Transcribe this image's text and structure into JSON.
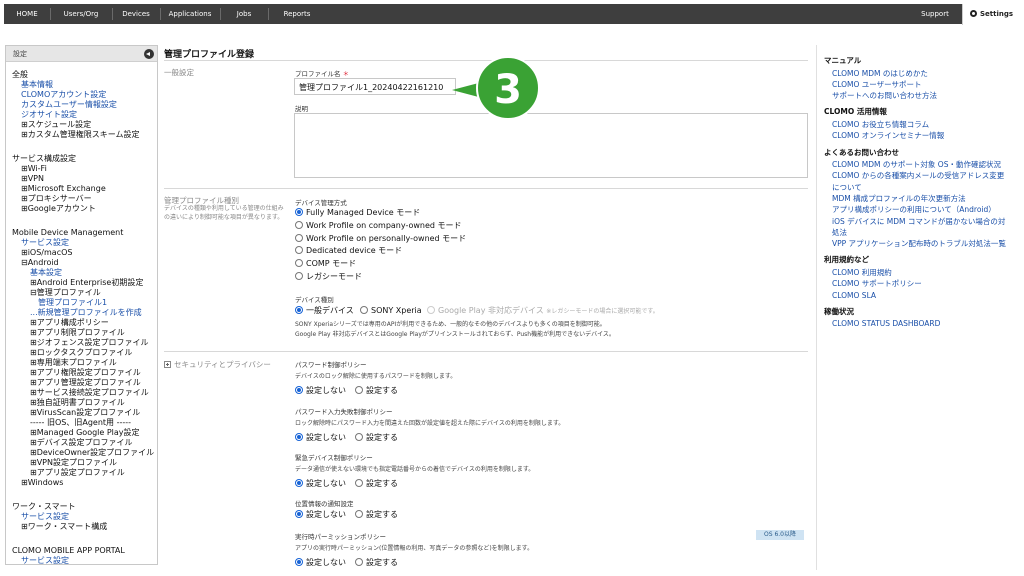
{
  "nav": {
    "items": [
      "HOME",
      "Users/Org",
      "Devices",
      "Applications",
      "Jobs",
      "Reports"
    ],
    "support": "Support",
    "settings": "Settings"
  },
  "sidebar": {
    "title": "設定",
    "items": [
      {
        "text": "全般",
        "kind": "head"
      },
      {
        "text": "基本情報",
        "kind": "link"
      },
      {
        "text": "CLOMOアカウント設定",
        "kind": "link"
      },
      {
        "text": "カスタムユーザー情報設定",
        "kind": "link"
      },
      {
        "text": "ジオサイト設定",
        "kind": "link"
      },
      {
        "text": "⊞スケジュール設定",
        "kind": "head"
      },
      {
        "text": "⊞カスタム管理権限スキーム設定",
        "kind": "head"
      },
      {
        "text": "サービス構成設定",
        "kind": "head"
      },
      {
        "text": "⊞Wi-Fi",
        "kind": "head"
      },
      {
        "text": "⊞VPN",
        "kind": "head"
      },
      {
        "text": "⊞Microsoft Exchange",
        "kind": "head"
      },
      {
        "text": "⊞プロキシサーバー",
        "kind": "head"
      },
      {
        "text": "⊞Googleアカウント",
        "kind": "head"
      },
      {
        "text": "Mobile Device Management",
        "kind": "head"
      },
      {
        "text": "サービス設定",
        "kind": "link"
      },
      {
        "text": "⊞iOS/macOS",
        "kind": "head"
      },
      {
        "text": "⊟Android",
        "kind": "head"
      },
      {
        "text": "基本設定",
        "kind": "link"
      },
      {
        "text": "⊞Android Enterprise初期設定",
        "kind": "head"
      },
      {
        "text": "⊟管理プロファイル",
        "kind": "head"
      },
      {
        "text": "管理プロファイル1",
        "kind": "link"
      },
      {
        "text": "...新規管理プロファイルを作成",
        "kind": "link"
      },
      {
        "text": "⊞アプリ構成ポリシー",
        "kind": "head"
      },
      {
        "text": "⊞アプリ制限プロファイル",
        "kind": "head"
      },
      {
        "text": "⊞ジオフェンス設定プロファイル",
        "kind": "head"
      },
      {
        "text": "⊞ロックタスクプロファイル",
        "kind": "head"
      },
      {
        "text": "⊞専用端末プロファイル",
        "kind": "head"
      },
      {
        "text": "⊞アプリ権限設定プロファイル",
        "kind": "head"
      },
      {
        "text": "⊞アプリ管理設定プロファイル",
        "kind": "head"
      },
      {
        "text": "⊞サービス接続設定プロファイル",
        "kind": "head"
      },
      {
        "text": "⊞独自証明書プロファイル",
        "kind": "head"
      },
      {
        "text": "⊞VirusScan設定プロファイル",
        "kind": "head"
      },
      {
        "text": "----- 旧OS、旧Agent用 -----",
        "kind": "head"
      },
      {
        "text": "⊞Managed Google Play設定",
        "kind": "head"
      },
      {
        "text": "⊞デバイス設定プロファイル",
        "kind": "head"
      },
      {
        "text": "⊞DeviceOwner設定プロファイル",
        "kind": "head"
      },
      {
        "text": "⊞VPN設定プロファイル",
        "kind": "head"
      },
      {
        "text": "⊞アプリ設定プロファイル",
        "kind": "head"
      },
      {
        "text": "⊞Windows",
        "kind": "head"
      },
      {
        "text": "ワーク・スマート",
        "kind": "head"
      },
      {
        "text": "サービス設定",
        "kind": "link"
      },
      {
        "text": "⊞ワーク・スマート構成",
        "kind": "head"
      },
      {
        "text": "CLOMO MOBILE APP PORTAL",
        "kind": "head"
      },
      {
        "text": "サービス設定",
        "kind": "link"
      }
    ]
  },
  "main": {
    "title": "管理プロファイル登録",
    "general": {
      "label": "一般設定",
      "name_label": "プロファイル名",
      "required_mark": "＊",
      "name_value": "管理プロファイル1_20240422161210",
      "desc_label": "説明",
      "desc_value": ""
    },
    "kind": {
      "label": "管理プロファイル種別",
      "desc": "デバイスの種類や利用している管理の仕組みの違いにより制御可能な項目が異なります。",
      "mgmt_label": "デバイス管理方式",
      "mgmt_options": [
        {
          "text": "Fully Managed Device モード",
          "on": true
        },
        {
          "text": "Work Profile on company-owned モード",
          "on": false
        },
        {
          "text": "Work Profile on personally-owned モード",
          "on": false
        },
        {
          "text": "Dedicated device モード",
          "on": false
        },
        {
          "text": "COMP モード",
          "on": false
        },
        {
          "text": "レガシーモード",
          "on": false
        }
      ],
      "type_label": "デバイス種別",
      "type_options": [
        "一般デバイス",
        "SONY Xperia",
        "Google Play 非対応デバイス"
      ],
      "type_hint": "※レガシーモードの場合に選択可能です。",
      "note1": "SONY Xperiaシリーズでは専用のAPIが利用できるため、一般的なその他のデバイスよりも多くの項目を制御可能。",
      "note2": "Google Play 非対応デバイスとはGoogle Playがプリインストールされておらず、Push機能が利用できないデバイス。"
    },
    "security": {
      "label": "セキュリティとプライバシー",
      "on_label": "設定しない",
      "off_label": "設定する",
      "os_badge": "OS 6.0以降",
      "policies": [
        {
          "title": "パスワード制御ポリシー",
          "desc": "デバイスのロック解除に使用するパスワードを制限します。"
        },
        {
          "title": "パスワード入力失敗制御ポリシー",
          "desc": "ロック解除時にパスワード入力を間違えた回数が設定値を超えた際にデバイスの利用を制限します。"
        },
        {
          "title": "緊急デバイス制御ポリシー",
          "desc": "データ通信が使えない環境でも指定電話番号からの着信でデバイスの利用を制限します。"
        },
        {
          "title": "位置情報の通知設定",
          "desc": ""
        },
        {
          "title": "実行時パーミッションポリシー",
          "desc": "アプリの実行時パーミッション(位置情報の利用、写真データの参照など)を制限します。"
        }
      ]
    },
    "callout_number": "3"
  },
  "help": {
    "sections": [
      {
        "title": "マニュアル",
        "links": [
          "CLOMO MDM のはじめかた",
          "CLOMO ユーザーサポート",
          "サポートへのお問い合わせ方法"
        ]
      },
      {
        "title": "CLOMO 活用情報",
        "links": [
          "CLOMO お役立ち情報コラム",
          "CLOMO オンラインセミナー情報"
        ]
      },
      {
        "title": "よくあるお問い合わせ",
        "links": [
          "CLOMO MDM のサポート対象 OS・動作確認状況",
          "CLOMO からの各種案内メールの受信アドレス変更",
          "について",
          "MDM 構成プロファイルの年次更新方法",
          "アプリ構成ポリシーの利用について（Android）",
          "iOS デバイスに MDM コマンドが届かない場合の対",
          "処法",
          "VPP アプリケーション配布時のトラブル対処法一覧"
        ]
      },
      {
        "title": "利用規約など",
        "links": [
          "CLOMO 利用規約",
          "CLOMO サポートポリシー",
          "CLOMO SLA"
        ]
      },
      {
        "title": "稼働状況",
        "links": [
          "CLOMO STATUS DASHBOARD"
        ]
      }
    ]
  }
}
